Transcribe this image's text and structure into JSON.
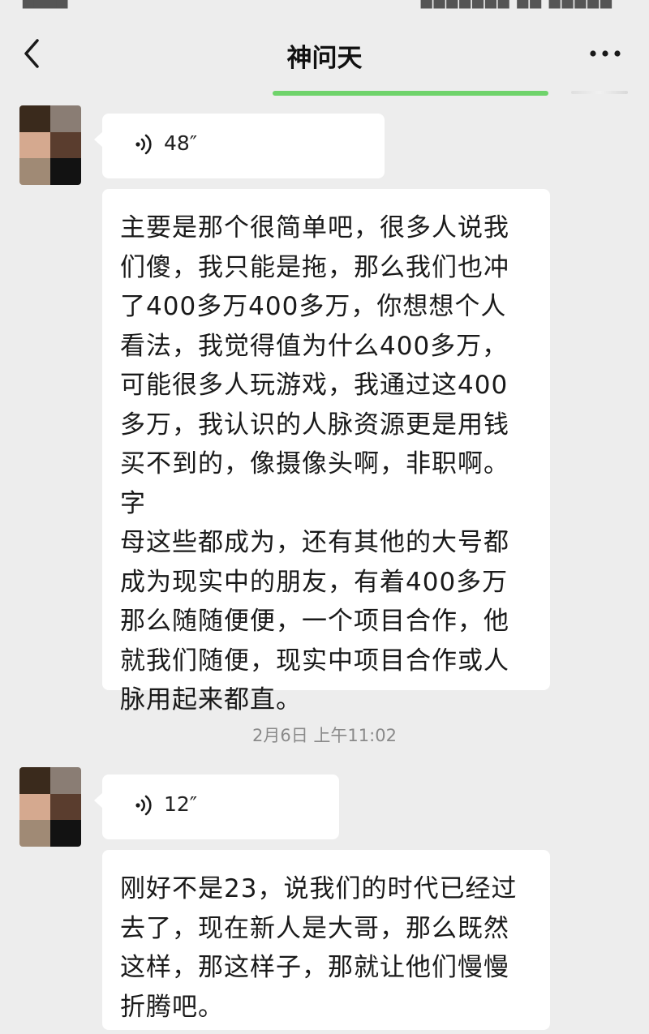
{
  "header": {
    "title": "神问天",
    "back_icon": "chevron-left-icon",
    "more_icon": "more-horizontal-icon"
  },
  "messages": [
    {
      "type": "voice",
      "duration": "48″",
      "icon": "voice-wave-icon"
    },
    {
      "type": "text",
      "text": "主要是那个很简单吧，很多人说我\n们傻，我只能是拖，那么我们也冲\n了400多万400多万，你想想个人\n看法，我觉得值为什么400多万，\n可能很多人玩游戏，我通过这400\n多万，我认识的人脉资源更是用钱\n买不到的，像摄像头啊，非职啊。字\n母这些都成为，还有其他的大号都\n成为现实中的朋友，有着400多万\n那么随随便便，一个项目合作，他\n就我们随便，现实中项目合作或人\n脉用起来都直。"
    },
    {
      "type": "timestamp",
      "text": "2月6日 上午11:02"
    },
    {
      "type": "voice",
      "duration": "12″",
      "icon": "voice-wave-icon"
    },
    {
      "type": "text",
      "text": "刚好不是23，说我们的时代已经过\n去了，现在新人是大哥，那么既然\n这样，那这样子，那就让他们慢慢\n折腾吧。"
    }
  ],
  "colors": {
    "background": "#ededed",
    "bubble": "#ffffff",
    "accent_line": "#6fd36b",
    "timestamp_text": "#8a8a8a"
  }
}
